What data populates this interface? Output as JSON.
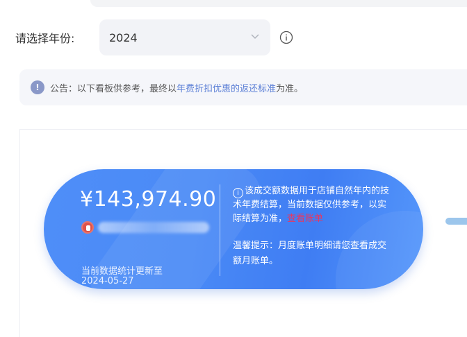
{
  "filter": {
    "year_label": "请选择年份:",
    "year_value": "2024"
  },
  "notice": {
    "prefix": "公告：以下看板供参考，最终以",
    "link": "年费折扣优惠的返还标准",
    "suffix": "为准。"
  },
  "summary": {
    "amount": "¥143,974.90",
    "update_label": "当前数据统计更新至",
    "update_date": "2024-05-27",
    "desc_text": "该成交额数据用于店铺自然年内的技术年费结算，当前数据仅供参考，以实际结算为准，",
    "view_link": "查看账单",
    "tip": "温馨提示：月度账单明细请您查看成交额月账单。"
  },
  "colors": {
    "card_blue": "#4a8af6",
    "link_blue": "#5b7fd6",
    "link_red": "#e8375f"
  },
  "icons": {
    "select_chevron": "chevron-down-icon",
    "year_info": "info-icon",
    "notice": "exclamation-icon",
    "desc_info": "info-icon",
    "shop": "shop-logo"
  }
}
